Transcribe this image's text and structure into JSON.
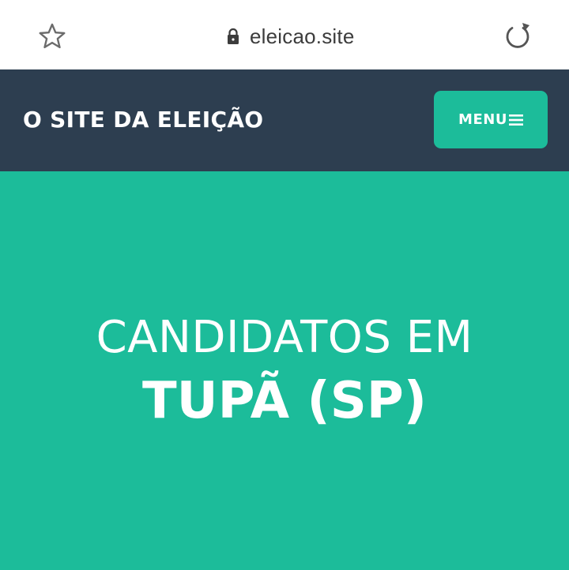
{
  "browser": {
    "url": "eleicao.site",
    "icons": {
      "bookmark": "star-icon",
      "secure": "lock-icon",
      "reload": "reload-icon"
    }
  },
  "header": {
    "title": "O SITE DA ELEIÇÃO",
    "menu_label": "MENU",
    "menu_icon": "hamburger-icon"
  },
  "hero": {
    "line1": "CANDIDATOS EM",
    "line2": "TUPÃ (SP)"
  },
  "colors": {
    "accent": "#1cbc9a",
    "header_bg": "#2d3e50",
    "browser_bg": "#ffffff",
    "text_light": "#ffffff"
  }
}
